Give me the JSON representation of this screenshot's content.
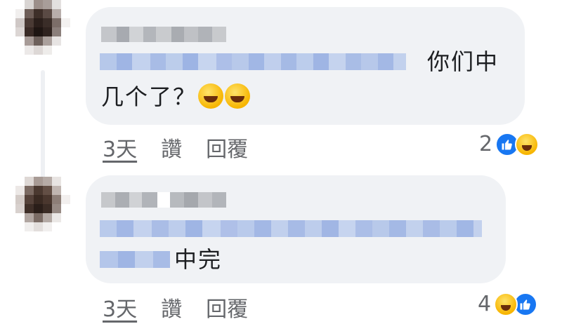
{
  "comments": [
    {
      "author": "",
      "text_line1": "你们中",
      "text_line2": "几个了？",
      "emojis": [
        "rolling-on-floor-laughing-icon",
        "rolling-on-floor-laughing-icon"
      ],
      "time": "3天",
      "like_label": "讚",
      "reply_label": "回覆",
      "reaction_count": "2",
      "reactions": [
        "like-icon",
        "haha-icon"
      ]
    },
    {
      "author": "",
      "text_line2": "中完",
      "time": "3天",
      "like_label": "讚",
      "reply_label": "回覆",
      "reaction_count": "4",
      "reactions": [
        "haha-icon",
        "like-icon"
      ]
    }
  ],
  "colors": {
    "bubble": "#f0f2f5",
    "text": "#1c1e21",
    "meta": "#65676b",
    "like_blue": "#1877f2",
    "blur_name": "#b9bcc2",
    "blur_mention": "#a9c1ea"
  }
}
